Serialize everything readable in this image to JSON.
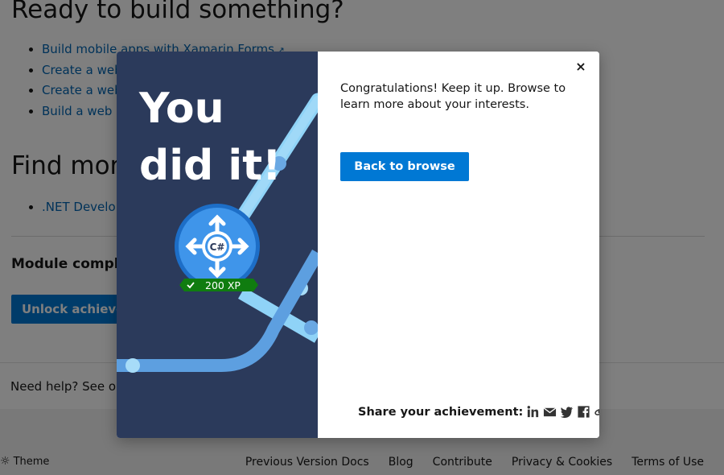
{
  "background": {
    "heading_ready": "Ready to build something?",
    "links_ready": [
      "Build mobile apps with Xamarin.Forms",
      "Create a web",
      "Create a web",
      "Build a web a"
    ],
    "heading_find": "Find more",
    "links_find": [
      ".NET Develop"
    ],
    "module_complete": "Module complet",
    "unlock_button": "Unlock achieveme",
    "help_text": "Need help? See ou",
    "footer": {
      "theme_label": "Theme",
      "links": [
        "Previous Version Docs",
        "Blog",
        "Contribute",
        "Privacy & Cookies",
        "Terms of Use"
      ]
    }
  },
  "modal": {
    "hero_line1": "You",
    "hero_line2": "did it!",
    "badge_text": "C#",
    "xp_label": "200 XP",
    "message": "Congratulations! Keep it up. Browse to learn more about your interests.",
    "back_button": "Back to browse",
    "close_label": "×",
    "share_label": "Share your achievement:",
    "share_icons": [
      "linkedin-icon",
      "mail-icon",
      "twitter-icon",
      "facebook-icon",
      "link-icon"
    ]
  },
  "colors": {
    "accent": "#0078d4",
    "link": "#0065b3",
    "panel": "#2b3a5b",
    "xp_green": "#107c10",
    "overlay": "rgba(0,0,0,0.5)"
  }
}
